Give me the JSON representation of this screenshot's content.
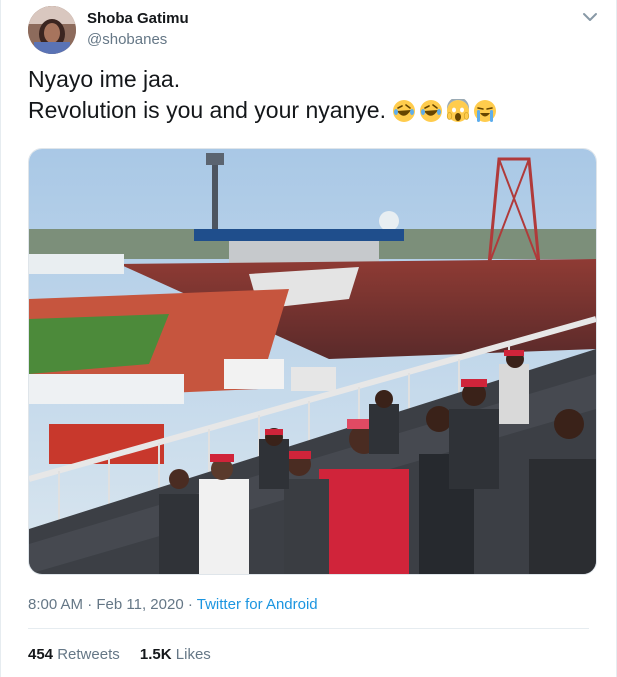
{
  "user": {
    "name": "Shoba Gatimu",
    "handle": "@shobanes"
  },
  "tweet": {
    "line1": "Nyayo ime jaa.",
    "line2": "Revolution is you and your nyanye.",
    "emojis": [
      "rolling-on-floor-laughing",
      "rolling-on-floor-laughing",
      "face-screaming-in-fear",
      "loudly-crying-face"
    ]
  },
  "meta": {
    "time": "8:00 AM",
    "separator": "·",
    "date": "Feb 11, 2020",
    "source": "Twitter for Android"
  },
  "stats": {
    "retweets_count": "454",
    "retweets_label": "Retweets",
    "likes_count": "1.5K",
    "likes_label": "Likes"
  },
  "colors": {
    "link": "#1b95e0",
    "muted": "#657786",
    "text": "#14171a",
    "track": "#c6553e",
    "seat_red": "#d0243a"
  }
}
